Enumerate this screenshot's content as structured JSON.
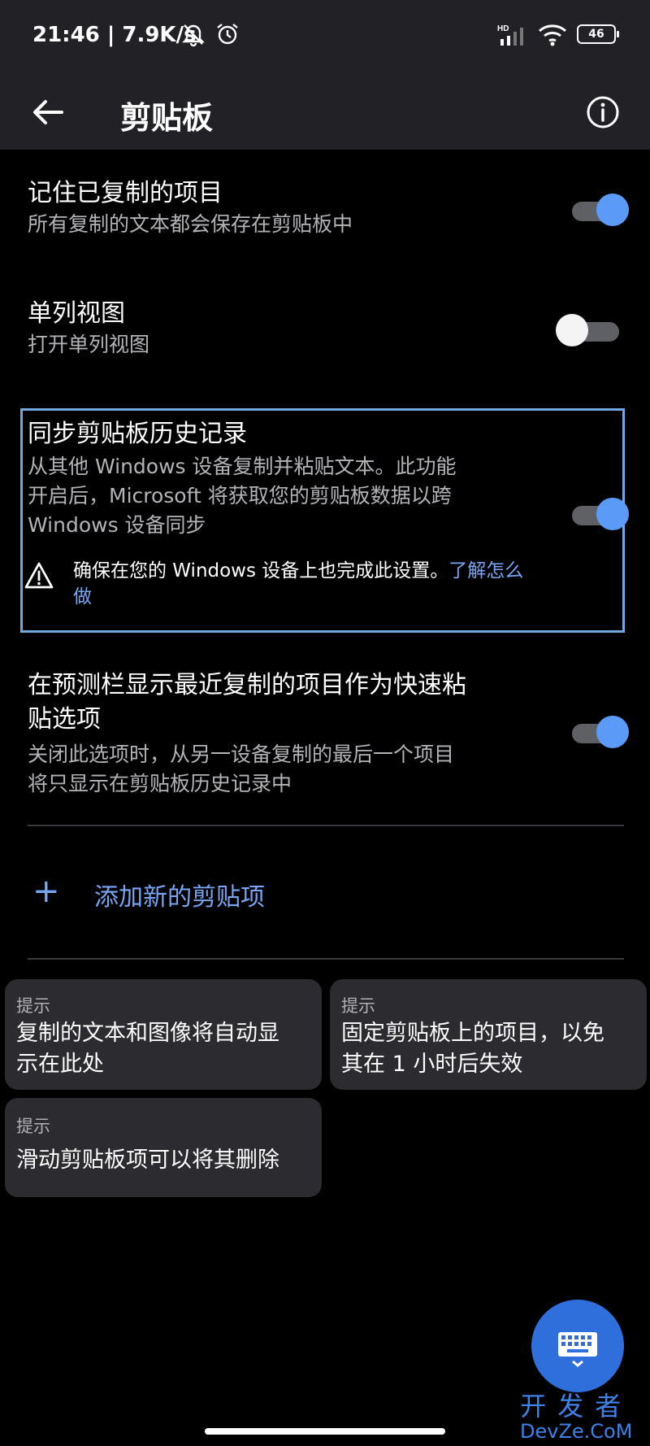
{
  "status": {
    "time": "21:46 | 7.9K/s",
    "battery": "46",
    "network_label": "HD"
  },
  "appbar": {
    "title": "剪贴板"
  },
  "settings": [
    {
      "title": "记住已复制的项目",
      "subtitle": "所有复制的文本都会保存在剪贴板中",
      "toggle": "on"
    },
    {
      "title": "单列视图",
      "subtitle": "打开单列视图",
      "toggle": "off"
    },
    {
      "title": "同步剪贴板历史记录",
      "subtitle_lines": [
        "从其他 Windows 设备复制并粘贴文本。此功能",
        "开启后，Microsoft 将获取您的剪贴板数据以跨",
        "Windows 设备同步"
      ],
      "toggle": "on"
    },
    {
      "title_lines": [
        "在预测栏显示最近复制的项目作为快速粘",
        "贴选项"
      ],
      "subtitle_lines": [
        "关闭此选项时，从另一设备复制的最后一个项目",
        "将只显示在剪贴板历史记录中"
      ],
      "toggle": "on"
    }
  ],
  "sync_warning": {
    "text": "确保在您的 Windows 设备上也完成此设置。",
    "link": "了解怎么做"
  },
  "add_item": {
    "label": "添加新的剪贴项"
  },
  "tips": [
    {
      "label": "提示",
      "lines": [
        "复制的文本和图像将自动显",
        "示在此处"
      ]
    },
    {
      "label": "提示",
      "lines": [
        "固定剪贴板上的项目，以免",
        "其在 1 小时后失效"
      ]
    },
    {
      "label": "提示",
      "lines": [
        "滑动剪贴板项可以将其删除"
      ]
    }
  ],
  "watermark": {
    "cn": "开发者",
    "en": "DevZe.CoM"
  },
  "colors": {
    "accent": "#5b9bf7",
    "link": "#78a6f5",
    "fab": "#2f6fdb",
    "focus_border": "#6fa9e0"
  }
}
